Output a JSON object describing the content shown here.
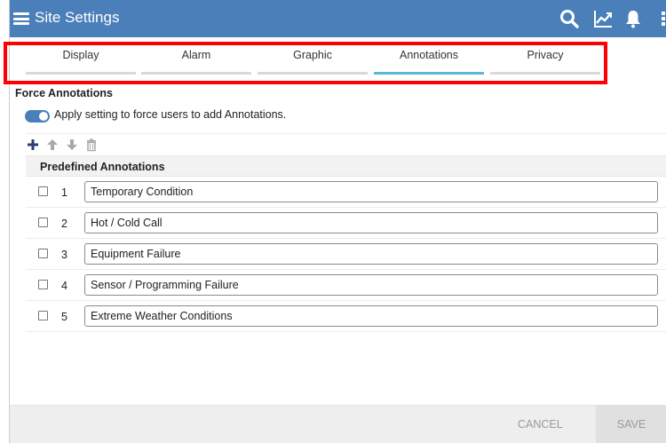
{
  "header": {
    "title": "Site Settings",
    "bg_color": "#4a7fba",
    "icons": [
      "menu-icon",
      "search-icon",
      "trend-chart-icon",
      "bell-icon",
      "more-vert-icon"
    ]
  },
  "tabs": [
    {
      "label": "Display",
      "active": false
    },
    {
      "label": "Alarm",
      "active": false
    },
    {
      "label": "Graphic",
      "active": false
    },
    {
      "label": "Annotations",
      "active": true
    },
    {
      "label": "Privacy",
      "active": false
    }
  ],
  "highlight_color": "#ff0000",
  "accent_color": "#5bb8d6",
  "force_annotations": {
    "title": "Force Annotations",
    "toggle_on": true,
    "toggle_label": "Apply setting to force users to add Annotations."
  },
  "list_actions": [
    "add-icon",
    "arrow-up-icon",
    "arrow-down-icon",
    "trash-icon"
  ],
  "predefined": {
    "header": "Predefined Annotations",
    "rows": [
      {
        "num": "1",
        "value": "Temporary Condition"
      },
      {
        "num": "2",
        "value": "Hot / Cold Call"
      },
      {
        "num": "3",
        "value": "Equipment Failure"
      },
      {
        "num": "4",
        "value": "Sensor / Programming Failure"
      },
      {
        "num": "5",
        "value": "Extreme Weather Conditions"
      }
    ]
  },
  "footer": {
    "cancel": "CANCEL",
    "save": "SAVE"
  }
}
